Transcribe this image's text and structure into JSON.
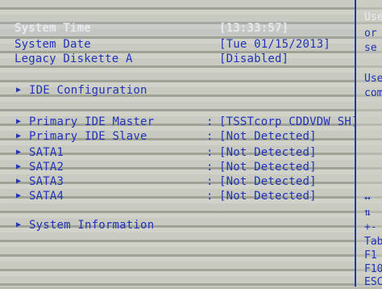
{
  "main": {
    "system_time": {
      "label": "System Time",
      "value": "[13:33:57]"
    },
    "system_date": {
      "label": "System Date",
      "value": "[Tue 01/15/2013]"
    },
    "legacy_diskette": {
      "label": "Legacy Diskette A",
      "value": "[Disabled]"
    },
    "ide_configuration": {
      "label": "IDE Configuration"
    },
    "primary_master": {
      "label": "Primary IDE Master",
      "colon": ":",
      "value": "[TSSTcorp CDDVDW SH]"
    },
    "primary_slave": {
      "label": "Primary IDE Slave",
      "colon": ":",
      "value": "[Not Detected]"
    },
    "sata1": {
      "label": "SATA1",
      "colon": ":",
      "value": "[Not Detected]"
    },
    "sata2": {
      "label": "SATA2",
      "colon": ":",
      "value": "[Not Detected]"
    },
    "sata3": {
      "label": "SATA3",
      "colon": ":",
      "value": "[Not Detected]"
    },
    "sata4": {
      "label": "SATA4",
      "colon": ":",
      "value": "[Not Detected]"
    },
    "system_information": {
      "label": "System Information"
    }
  },
  "help": {
    "line1": "Use",
    "line2": "or",
    "line3": "se",
    "line4": "Use",
    "line5": "com",
    "key_lr": "↔",
    "key_ud": "⇅",
    "key_pm": "+-",
    "key_tab": "Tab",
    "key_f1": "F1",
    "key_f10": "F10",
    "key_esc": "ESC"
  },
  "colors": {
    "text": "#2133b8",
    "highlight": "#e8e8f2"
  }
}
